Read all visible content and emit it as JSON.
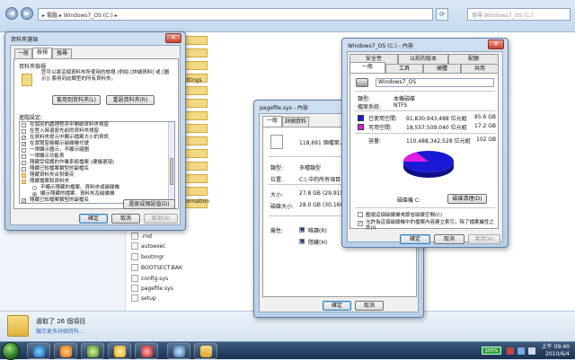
{
  "explorer": {
    "address": "▸ 電腦 ▸ Windows7_OS (C:) ▸",
    "search_placeholder": "搜尋 Windows7_OS (C:)",
    "back_icon": "back-arrow-icon",
    "files": [
      "ettings",
      "formation",
      ".rnd",
      "autoexec",
      "bootmgr",
      "BOOTSECT.BAK",
      "config.sys",
      "pagefile.sys",
      "setup"
    ],
    "status_selected": "選取了 26 個項目",
    "status_link": "顯示更多詳細資料..."
  },
  "folder_options": {
    "title": "資料夾選項",
    "tabs": [
      "一般",
      "檢視",
      "搜尋"
    ],
    "section_views": "資料夾檢視",
    "views_desc": "您可以將這個資料夾所使用的檢視 (例如 [詳細資料] 或 [圖示]) 套用到此類型的所有資料夾。",
    "apply_button": "套用到資料夾(L)",
    "reset_folders_button": "重設資料夾(R)",
    "advanced_label": "進階設定:",
    "settings": [
      {
        "text": "在個別的處理程序中開啟資料夾視窗",
        "checked": false,
        "kind": "check"
      },
      {
        "text": "在登入時還原先前的資料夾視窗",
        "checked": false,
        "kind": "check"
      },
      {
        "text": "在資料夾提示中顯示檔案大小的資訊",
        "checked": true,
        "kind": "check"
      },
      {
        "text": "在瀏覽窗格顯示磁碟機代號",
        "checked": true,
        "kind": "check"
      },
      {
        "text": "一律顯示圖示，不顯示縮圖",
        "checked": false,
        "kind": "check"
      },
      {
        "text": "一律顯示功能表",
        "checked": false,
        "kind": "check"
      },
      {
        "text": "隱藏受保護的作業系統檔案 (建議選項)",
        "checked": false,
        "kind": "check"
      },
      {
        "text": "隱藏已知檔案類型的副檔名",
        "checked": false,
        "kind": "check"
      },
      {
        "text": "隱藏資料夾合併衝突",
        "checked": false,
        "kind": "folder"
      },
      {
        "text": "隱藏檔案和資料夾",
        "checked": false,
        "kind": "folder"
      },
      {
        "text": "不顯示隱藏的檔案、資料夾或磁碟機",
        "checked": false,
        "kind": "radio"
      },
      {
        "text": "顯示隱藏的檔案、資料夾及磁碟機",
        "checked": true,
        "kind": "radio"
      },
      {
        "text": "隱藏已知檔案類型的副檔名",
        "checked": true,
        "kind": "check"
      }
    ],
    "restore_defaults_button": "還原成預設值(D)",
    "ok": "確定",
    "cancel": "取消",
    "apply": "套用(A)"
  },
  "pagefile_props": {
    "title": "pagefile.sys - 內容",
    "tabs": [
      "一般",
      "詳細資料"
    ],
    "count_text": "118,691 個檔案，1",
    "rows": [
      {
        "label": "類型:",
        "value": "多種類型"
      },
      {
        "label": "位置:",
        "value": "C:\\ 中的所有項目"
      },
      {
        "label": "大小:",
        "value": "27.8 GB (29,915,7"
      },
      {
        "label": "磁碟大小:",
        "value": "28.0 GB (30,160,7"
      }
    ],
    "attr_label": "屬性:",
    "readonly": "唯讀(R)",
    "hidden": "隱藏(H)",
    "ok": "確定",
    "cancel": "取消"
  },
  "drive_props": {
    "title": "Windows7_OS (C:) - 內容",
    "tabs_row1": [
      "安全性",
      "以前的版本",
      "配額"
    ],
    "tabs_row2": [
      "一般",
      "工具",
      "硬體",
      "共用"
    ],
    "name_value": "Windows7_OS",
    "type_label": "類型:",
    "type_value": "本機磁碟",
    "fs_label": "檔案系統:",
    "fs_value": "NTFS",
    "used_label": "已使用空間:",
    "used_bytes": "91,830,943,488 位元組",
    "used_size": "85.6 GB",
    "free_label": "可用空間:",
    "free_bytes": "18,557,509,040 位元組",
    "free_size": "17.2 GB",
    "cap_label": "容量:",
    "cap_bytes": "110,488,342,528 位元組",
    "cap_size": "102 GB",
    "drive_label": "磁碟機 C:",
    "cleanup_button": "磁碟清理(D)",
    "compress_text": "壓縮這個磁碟機來節省磁碟空間(C)",
    "index_text": "允許為這個磁碟機中的檔案內容建立索引，除了檔案屬性之外(I)",
    "ok": "確定",
    "cancel": "取消",
    "apply": "套用(A)",
    "colors": {
      "used": "#1a1ad6",
      "free": "#e01ee0"
    },
    "used_fraction": 0.832
  },
  "taskbar": {
    "battery": "100%",
    "time": "上午 09:40",
    "date": "2010/6/4"
  }
}
